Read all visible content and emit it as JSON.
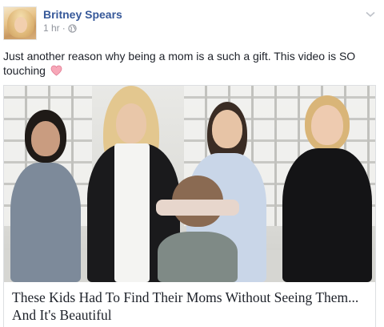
{
  "post": {
    "author": "Britney Spears",
    "time": "1 hr",
    "separator": "·",
    "message": "Just another reason why being a mom is a such a gift. This video is SO touching",
    "message_emoji": "heart-emoji",
    "privacy_icon": "globe-icon",
    "menu_icon": "chevron-down-icon"
  },
  "link_card": {
    "image": "video-thumbnail",
    "headline": "These Kids Had To Find Their Moms Without Seeing Them... And It's Beautiful"
  },
  "colors": {
    "author_link": "#365899",
    "meta_text": "#90949c",
    "body_text": "#1d2129",
    "card_border": "#dddfe2",
    "emoji_heart": "#f7a7b8"
  }
}
